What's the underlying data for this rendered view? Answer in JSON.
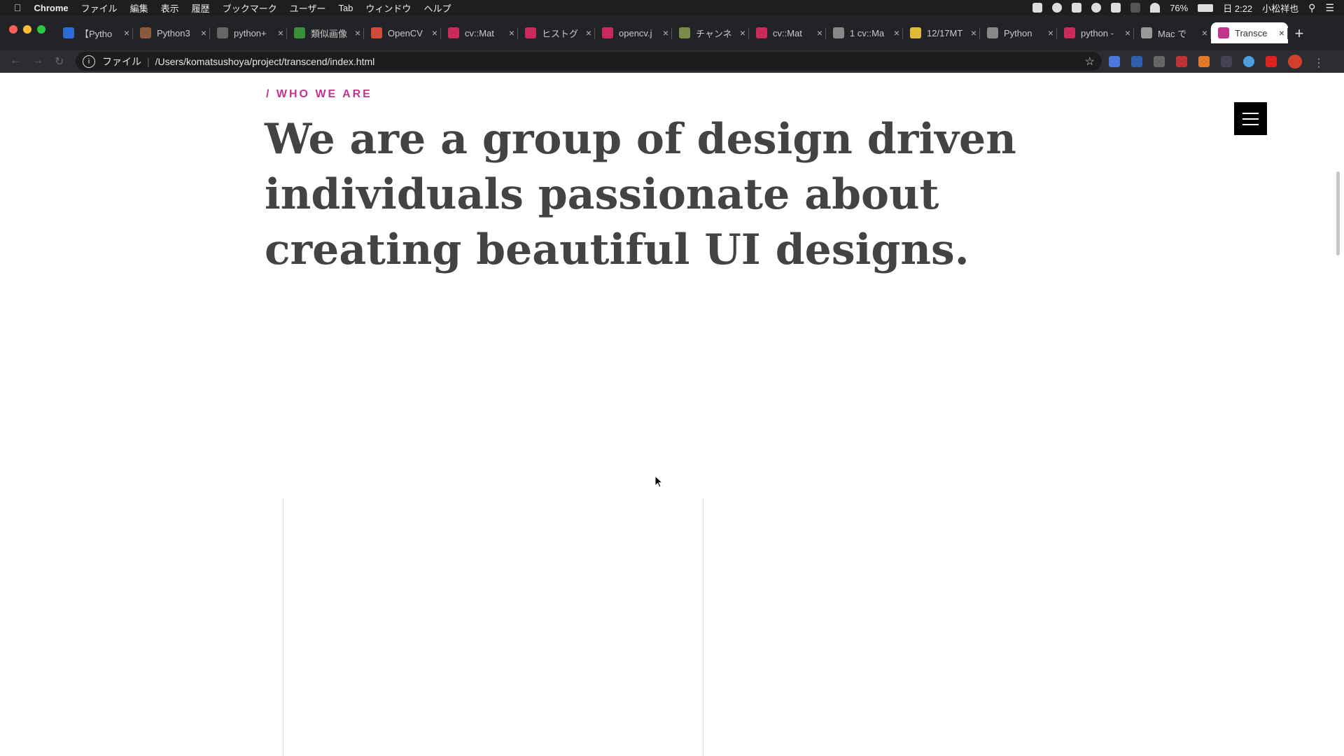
{
  "menubar": {
    "app": "Chrome",
    "items": [
      "ファイル",
      "編集",
      "表示",
      "履歴",
      "ブックマーク",
      "ユーザー",
      "Tab",
      "ウィンドウ",
      "ヘルプ"
    ],
    "battery": "76%",
    "clock": "日 2:22",
    "user": "小松祥也"
  },
  "tabs": [
    {
      "title": "【Pytho",
      "color": "#2b6dd1"
    },
    {
      "title": "Python3",
      "color": "#8b5a3c"
    },
    {
      "title": "python+",
      "color": "#666666"
    },
    {
      "title": "類似画像",
      "color": "#3a8f3a"
    },
    {
      "title": "OpenCV",
      "color": "#d14b3b"
    },
    {
      "title": "cv::Mat",
      "color": "#c92a5b"
    },
    {
      "title": "ヒストグ",
      "color": "#c92a5b"
    },
    {
      "title": "opencv.j",
      "color": "#c92a5b"
    },
    {
      "title": "チャンネ",
      "color": "#7a8a4a"
    },
    {
      "title": "cv::Mat",
      "color": "#c92a5b"
    },
    {
      "title": "1 cv::Ma",
      "color": "#888888"
    },
    {
      "title": "12/17MT",
      "color": "#e0b83a"
    },
    {
      "title": "Python",
      "color": "#888888"
    },
    {
      "title": "python -",
      "color": "#c92a5b"
    },
    {
      "title": "Mac で",
      "color": "#999999"
    },
    {
      "title": "Transce",
      "color": "#c1358f"
    }
  ],
  "active_tab_index": 15,
  "address": {
    "scheme": "ファイル",
    "url": "/Users/komatsushoya/project/transcend/index.html"
  },
  "page": {
    "eyebrow": "/ WHO WE ARE",
    "heading": "We are a group of design driven individuals passionate about creating beautiful UI designs.",
    "accent_color": "#c1358f"
  }
}
